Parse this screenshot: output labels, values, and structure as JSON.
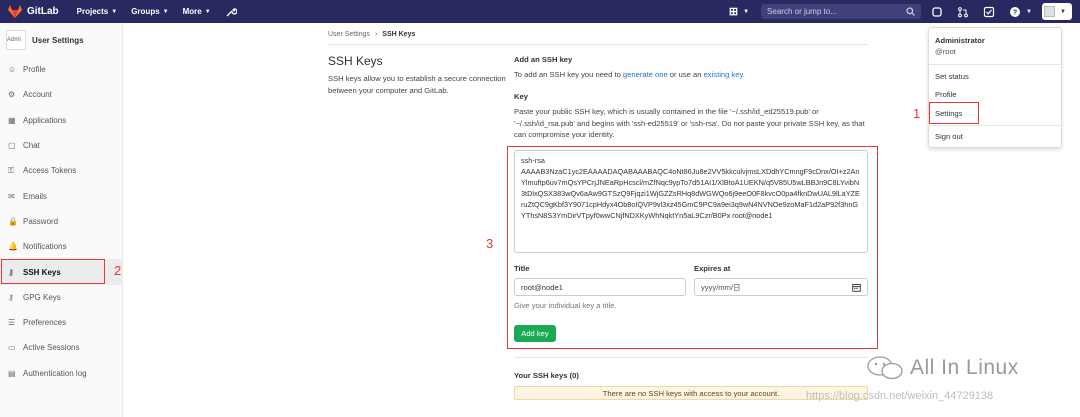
{
  "navbar": {
    "brand": "GitLab",
    "menus": [
      "Projects",
      "Groups",
      "More"
    ],
    "search_placeholder": "Search or jump to...",
    "caret": "⌄"
  },
  "sidebar": {
    "avatar_text": "Admi",
    "title": "User Settings",
    "items": [
      {
        "label": "Profile",
        "icon": "profile-icon"
      },
      {
        "label": "Account",
        "icon": "account-icon"
      },
      {
        "label": "Applications",
        "icon": "applications-icon"
      },
      {
        "label": "Chat",
        "icon": "chat-icon"
      },
      {
        "label": "Access Tokens",
        "icon": "access-tokens-icon"
      },
      {
        "label": "Emails",
        "icon": "emails-icon"
      },
      {
        "label": "Password",
        "icon": "password-icon"
      },
      {
        "label": "Notifications",
        "icon": "notifications-icon"
      },
      {
        "label": "SSH Keys",
        "icon": "key-icon",
        "active": true
      },
      {
        "label": "GPG Keys",
        "icon": "gpg-key-icon"
      },
      {
        "label": "Preferences",
        "icon": "preferences-icon"
      },
      {
        "label": "Active Sessions",
        "icon": "sessions-icon"
      },
      {
        "label": "Authentication log",
        "icon": "auth-log-icon"
      }
    ]
  },
  "breadcrumb": {
    "parent": "User Settings",
    "sep": "›",
    "current": "SSH Keys"
  },
  "page": {
    "title": "SSH Keys",
    "description": "SSH keys allow you to establish a secure connection between your computer and GitLab."
  },
  "add_key": {
    "heading": "Add an SSH key",
    "intro_prefix": "To add an SSH key you need to ",
    "link1": "generate one",
    "intro_middle": " or use an ",
    "link2": "existing key",
    "intro_suffix": ".",
    "key_label": "Key",
    "key_help": "Paste your public SSH key, which is usually contained in the file '~/.ssh/id_ed25519.pub' or '~/.ssh/id_rsa.pub' and begins with 'ssh-ed25519' or 'ssh-rsa'. Do not paste your private SSH key, as that can compromise your identity.",
    "key_line1": "ssh-rsa",
    "key_value": "AAAAB3NzaC1yc2EAAAADAQABAAABAQC4oNt86Ju8e2VV5kkculvjmsLXDdhYCmngF9cDnx/OI+z2AnYlmuftp6uv7mQsYPCrjJNEaRpHcscl/mZfNqc9ypTo7d51AI1/XlBtoA1UEKN/q5V85U5wLBBJn9C8LYvibN3tDlxQSX383wQv6aAw9GTSzQ9Fjqzi1WjGZZsRHq8dWGWQo6j9eeO0F8kvcO0pa4fknDwUAL9lLaYZEruZtQC9gKbf3Y9071cpHdyx4Ob8oIQVP9vl3xz45GmC9PC9a9ei3q9wN4NVNOe9zoMaF1d2aP92f3hnGYThsN8S3YmDirVTpyf0wwCNjfNDXKyWhNqktYn5aL9Czr/B0Px root@node1",
    "title_label": "Title",
    "title_value": "root@node1",
    "title_help": "Give your individual key a title.",
    "expires_label": "Expires at",
    "expires_placeholder": "yyyy/mm/日",
    "button": "Add key"
  },
  "your_keys": {
    "heading": "Your SSH keys (0)",
    "empty_notice": "There are no SSH keys with access to your account."
  },
  "user_menu": {
    "name": "Administrator",
    "username": "@root",
    "items": [
      "Set status",
      "Profile",
      "Settings",
      "Sign out"
    ]
  },
  "annotations": {
    "n1": "1",
    "n2": "2",
    "n3": "3",
    "color": "#e53935"
  },
  "watermark": {
    "text": "All In Linux",
    "url": "https://blog.csdn.net/weixin_44729138"
  },
  "colors": {
    "navbar": "#292961",
    "accent": "#1f78d1",
    "button": "#1aaa55"
  }
}
